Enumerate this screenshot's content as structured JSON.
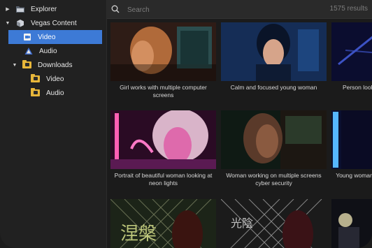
{
  "sidebar": {
    "items": [
      {
        "label": "Explorer",
        "icon": "folder-icon",
        "level": 0,
        "arrow": "right",
        "selected": false
      },
      {
        "label": "Vegas Content",
        "icon": "package-icon",
        "level": 0,
        "arrow": "down",
        "selected": false
      },
      {
        "label": "Video",
        "icon": "video-file-icon",
        "level": 1,
        "arrow": "",
        "selected": true
      },
      {
        "label": "Audio",
        "icon": "audio-file-icon",
        "level": 1,
        "arrow": "",
        "selected": false
      },
      {
        "label": "Downloads",
        "icon": "downloads-folder-icon",
        "level": 0,
        "arrow": "down",
        "selected": false
      },
      {
        "label": "Video",
        "icon": "video-folder-icon",
        "level": 2,
        "arrow": "",
        "selected": false
      },
      {
        "label": "Audio",
        "icon": "audio-folder-icon",
        "level": 2,
        "arrow": "",
        "selected": false
      }
    ]
  },
  "search": {
    "placeholder": "Search",
    "value": "",
    "result_count": "1575 results"
  },
  "grid": {
    "cards": [
      {
        "caption": "Girl works with multiple computer screens",
        "palette": [
          "#2e1c16",
          "#b06a3a",
          "#2b5a5c"
        ]
      },
      {
        "caption": "Calm and focused young woman",
        "palette": [
          "#0d1f3d",
          "#2f74c9",
          "#1a3768"
        ]
      },
      {
        "caption": "Person looking at glowing lights",
        "palette": [
          "#0a0b2a",
          "#3847c8",
          "#12143a"
        ]
      },
      {
        "caption": "Portrait of beautiful woman looking at neon lights",
        "palette": [
          "#2a0b24",
          "#e04aa0",
          "#5a1a52"
        ]
      },
      {
        "caption": "Woman working on multiple screens cyber security",
        "palette": [
          "#0f1a14",
          "#3b5a3c",
          "#1c1712"
        ]
      },
      {
        "caption": "Young woman looking at holographic lights",
        "palette": [
          "#0b1030",
          "#2a44a8",
          "#0a0a22"
        ]
      },
      {
        "caption": "",
        "palette": [
          "#1c2418",
          "#7a8a3a",
          "#3a1410"
        ]
      },
      {
        "caption": "",
        "palette": [
          "#1b1b1b",
          "#8a8a8a",
          "#3a1216"
        ]
      },
      {
        "caption": "",
        "palette": [
          "#0f1016",
          "#4b4e60",
          "#111217"
        ]
      }
    ]
  }
}
